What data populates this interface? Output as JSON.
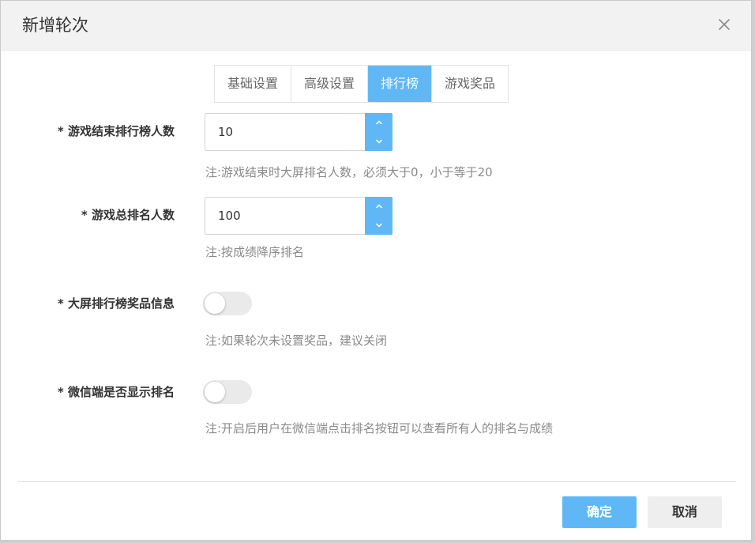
{
  "dialog": {
    "title": "新增轮次"
  },
  "tabs": [
    {
      "label": "基础设置",
      "active": false
    },
    {
      "label": "高级设置",
      "active": false
    },
    {
      "label": "排行榜",
      "active": true
    },
    {
      "label": "游戏奖品",
      "active": false
    }
  ],
  "fields": {
    "end_rank_count": {
      "label": "* 游戏结束排行榜人数",
      "value": "10",
      "note": "注:游戏结束时大屏排名人数，必须大于0，小于等于20"
    },
    "total_rank_count": {
      "label": "* 游戏总排名人数",
      "value": "100",
      "note": "注:按成绩降序排名"
    },
    "screen_prize_info": {
      "label": "* 大屏排行榜奖品信息",
      "enabled": false,
      "note": "注:如果轮次未设置奖品，建议关闭"
    },
    "wechat_show_rank": {
      "label": "* 微信端是否显示排名",
      "enabled": false,
      "note": "注:开启后用户在微信端点击排名按钮可以查看所有人的排名与成绩"
    }
  },
  "footer": {
    "confirm_label": "确定",
    "cancel_label": "取消"
  },
  "colors": {
    "accent": "#5fb8f5",
    "header_bg": "#f2f2f2",
    "note_text": "#8a8a8a",
    "switch_off": "#eaeaea"
  },
  "icons": {
    "close": "close-icon",
    "up": "chevron-up-icon",
    "down": "chevron-down-icon"
  }
}
